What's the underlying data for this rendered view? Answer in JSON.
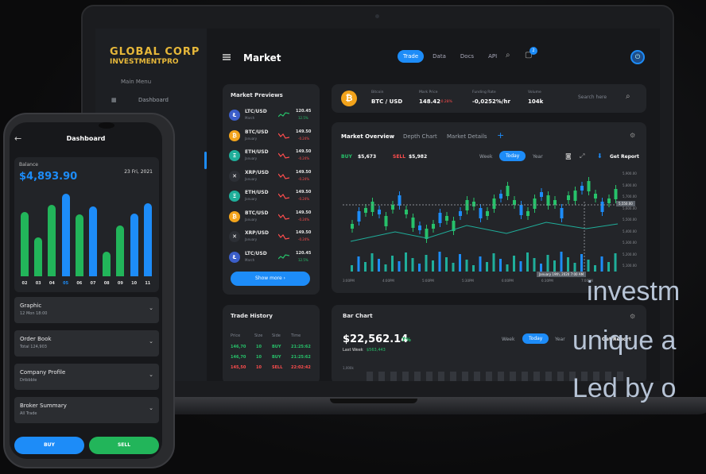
{
  "app": {
    "logo_text": "GLOBAL CORP",
    "logo_sub": "INVESTMENTPRO",
    "page_title": "Market",
    "menu_label": "Main Menu",
    "sidebar_items": [
      "Dashboard"
    ],
    "tabs": [
      {
        "label": "Trade",
        "active": true
      },
      {
        "label": "Data"
      },
      {
        "label": "Docs"
      },
      {
        "label": "API"
      }
    ],
    "notification_count": "2"
  },
  "market_previews": {
    "title": "Market Previews",
    "rows": [
      {
        "pair": "LTC/USD",
        "sub": "March",
        "price": "120.45",
        "change": "12.5%",
        "trend": "up",
        "coin": "Ł",
        "color": "#3b5ec9"
      },
      {
        "pair": "BTC/USD",
        "sub": "January",
        "price": "149.50",
        "change": "-0.24%",
        "trend": "down",
        "coin": "₿",
        "color": "#f2a31b"
      },
      {
        "pair": "ETH/USD",
        "sub": "January",
        "price": "149.50",
        "change": "-0.24%",
        "trend": "down",
        "coin": "Ξ",
        "color": "#1fae9a"
      },
      {
        "pair": "XRP/USD",
        "sub": "January",
        "price": "149.50",
        "change": "-0.24%",
        "trend": "down",
        "coin": "✕",
        "color": "#2c2f35"
      },
      {
        "pair": "ETH/USD",
        "sub": "January",
        "price": "149.50",
        "change": "-0.24%",
        "trend": "down",
        "coin": "Ξ",
        "color": "#1fae9a"
      },
      {
        "pair": "BTC/USD",
        "sub": "January",
        "price": "149.50",
        "change": "-0.24%",
        "trend": "down",
        "coin": "₿",
        "color": "#f2a31b"
      },
      {
        "pair": "XRP/USD",
        "sub": "January",
        "price": "149.50",
        "change": "-0.24%",
        "trend": "down",
        "coin": "✕",
        "color": "#2c2f35"
      },
      {
        "pair": "LTC/USD",
        "sub": "March",
        "price": "120.45",
        "change": "12.5%",
        "trend": "up",
        "coin": "Ł",
        "color": "#3b5ec9"
      }
    ],
    "show_more": "Show more ›"
  },
  "ticker": {
    "coin_name": "Bitcoin",
    "pair": "BTC / USD",
    "mark_price_label": "Mark Price",
    "mark_price": "148.42",
    "mark_change": "-0.28%",
    "funding_label": "Funding Rate",
    "funding": "-0,0252%/hr",
    "volume_label": "Volume",
    "volume": "104k",
    "search_placeholder": "Search here"
  },
  "market_overview": {
    "tabs": [
      "Market Overview",
      "Depth Chart",
      "Market Details"
    ],
    "buy_label": "BUY",
    "buy_value": "$5,673",
    "sell_label": "SELL",
    "sell_value": "$5,982",
    "ranges": [
      "Week",
      "Today",
      "Year"
    ],
    "active_range": "Today",
    "report": "Get Report",
    "y_ticks": [
      "5,900.00",
      "5,800.00",
      "5,700.00",
      "5,600.00",
      "5,500.00",
      "5,400.00",
      "5,300.00",
      "5,200.00",
      "5,100.00"
    ],
    "x_ticks": [
      "3:00PM",
      "4:00PM",
      "5:00PM",
      "5:30PM",
      "6:00PM",
      "6:30PM",
      "7:00PM"
    ],
    "price_marker": "5,550.00",
    "crosshair_label": "January 19th, 2020 7:00 AM"
  },
  "trade_history": {
    "title": "Trade History",
    "headers": [
      "Price",
      "Size",
      "Side",
      "Time"
    ],
    "rows": [
      {
        "price": "146,70",
        "size": "10",
        "side": "BUY",
        "time": "21:25:62",
        "color": "#27c26a"
      },
      {
        "price": "146,70",
        "size": "10",
        "side": "BUY",
        "time": "21:25:62",
        "color": "#27c26a"
      },
      {
        "price": "145,50",
        "size": "10",
        "side": "SELL",
        "time": "22:02:42",
        "color": "#ff4d4d"
      }
    ]
  },
  "bar_chart": {
    "title": "Bar Chart",
    "value": "$22,562.14",
    "pct": "7%",
    "last_week_label": "Last Week",
    "last_week_value": "$563,443",
    "ranges": [
      "Week",
      "Today",
      "Year"
    ],
    "report": "Get Report",
    "y_first": "1,000k"
  },
  "overlay_lines": [
    "investm",
    "unique a",
    "Led by o"
  ],
  "phone": {
    "title": "Dashboard",
    "balance_label": "Balance",
    "balance": "$4,893.90",
    "date": "23 Fri, 2021",
    "chart_data": {
      "type": "bar",
      "categories": [
        "02",
        "03",
        "04",
        "05",
        "06",
        "07",
        "08",
        "09",
        "10",
        "11"
      ],
      "values": [
        74,
        45,
        82,
        95,
        71,
        80,
        28,
        58,
        72,
        84
      ],
      "highlight": "05",
      "colors": {
        "green": "#22b55a",
        "blue": "#1d8cf8"
      }
    },
    "accordions": [
      {
        "title": "Graphic",
        "sub": "12 Mon 18:00"
      },
      {
        "title": "Order Book",
        "sub": "Total 124,903"
      },
      {
        "title": "Company Profile",
        "sub": "Dribbble"
      },
      {
        "title": "Broker Summary",
        "sub": "All Trade"
      }
    ],
    "buy": "BUY",
    "sell": "SELL"
  }
}
